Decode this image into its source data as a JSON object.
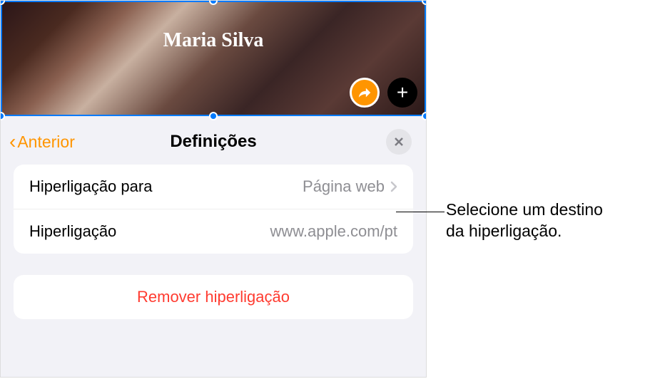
{
  "header": {
    "title": "Maria Silva"
  },
  "panel": {
    "back_label": "Anterior",
    "title": "Definições",
    "rows": {
      "link_to": {
        "label": "Hiperligação para",
        "value": "Página web"
      },
      "link": {
        "label": "Hiperligação",
        "value": "www.apple.com/pt"
      }
    },
    "remove_label": "Remover hiperligação"
  },
  "callout": {
    "line1": "Selecione um destino",
    "line2": "da hiperligação."
  }
}
